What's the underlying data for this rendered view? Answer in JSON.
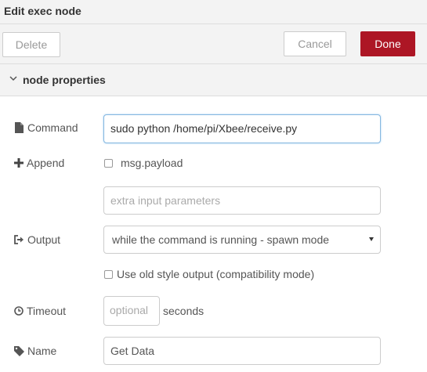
{
  "dialog": {
    "title": "Edit exec node",
    "delete_label": "Delete",
    "cancel_label": "Cancel",
    "done_label": "Done",
    "section_label": "node properties"
  },
  "fields": {
    "command": {
      "label": "Command",
      "value": "sudo python /home/pi/Xbee/receive.py"
    },
    "append": {
      "label": "Append",
      "checkbox_label": "msg.payload",
      "checked": false
    },
    "extra": {
      "placeholder": "extra input parameters"
    },
    "output": {
      "label": "Output",
      "selected": "while the command is running - spawn mode"
    },
    "old_style": {
      "label": "Use old style output (compatibility mode)",
      "checked": false
    },
    "timeout": {
      "label": "Timeout",
      "placeholder": "optional",
      "unit": "seconds"
    },
    "name": {
      "label": "Name",
      "value": "Get Data"
    }
  },
  "colors": {
    "accent": "#ad1625",
    "focus": "#85b7e0"
  },
  "icons": {
    "command": "file-icon",
    "append": "plus-icon",
    "output": "sign-out-icon",
    "timeout": "clock-icon",
    "name": "tag-icon",
    "section": "chevron-down-icon"
  }
}
